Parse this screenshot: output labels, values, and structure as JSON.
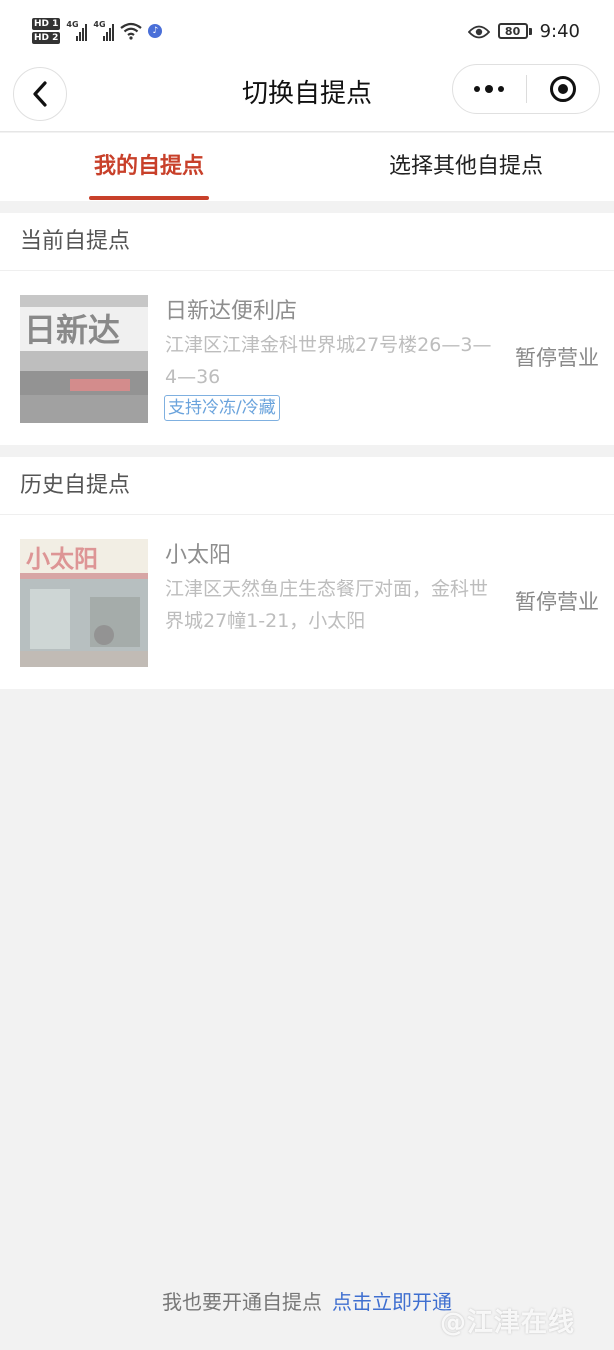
{
  "status_bar": {
    "sim1": "HD 1",
    "sim2": "HD 2",
    "network1": "4G",
    "network2": "4G",
    "battery": "80",
    "time": "9:40"
  },
  "nav": {
    "title": "切换自提点",
    "back_icon": "chevron-left-icon",
    "more_icon": "more-dots-icon",
    "close_icon": "target-circle-icon"
  },
  "tabs": [
    {
      "label": "我的自提点",
      "active": true
    },
    {
      "label": "选择其他自提点",
      "active": false
    }
  ],
  "current_section": {
    "title": "当前自提点",
    "store": {
      "name": "日新达便利店",
      "address": "江津区江津金科世界城27号楼26—3—4—36",
      "tag": "支持冷冻/冷藏",
      "status": "暂停营业",
      "sign_text": "日新达"
    }
  },
  "history_section": {
    "title": "历史自提点",
    "store": {
      "name": "小太阳",
      "address": "江津区天然鱼庄生态餐厅对面，金科世界城27幢1-21，小太阳",
      "status": "暂停营业",
      "sign_text": "小太阳"
    }
  },
  "footer": {
    "text": "我也要开通自提点",
    "link": "点击立即开通"
  },
  "watermark": "@江津在线",
  "colors": {
    "accent": "#c8402a",
    "link": "#3f6fd0",
    "tag": "#6aa3dc",
    "background": "#f2f2f2"
  }
}
